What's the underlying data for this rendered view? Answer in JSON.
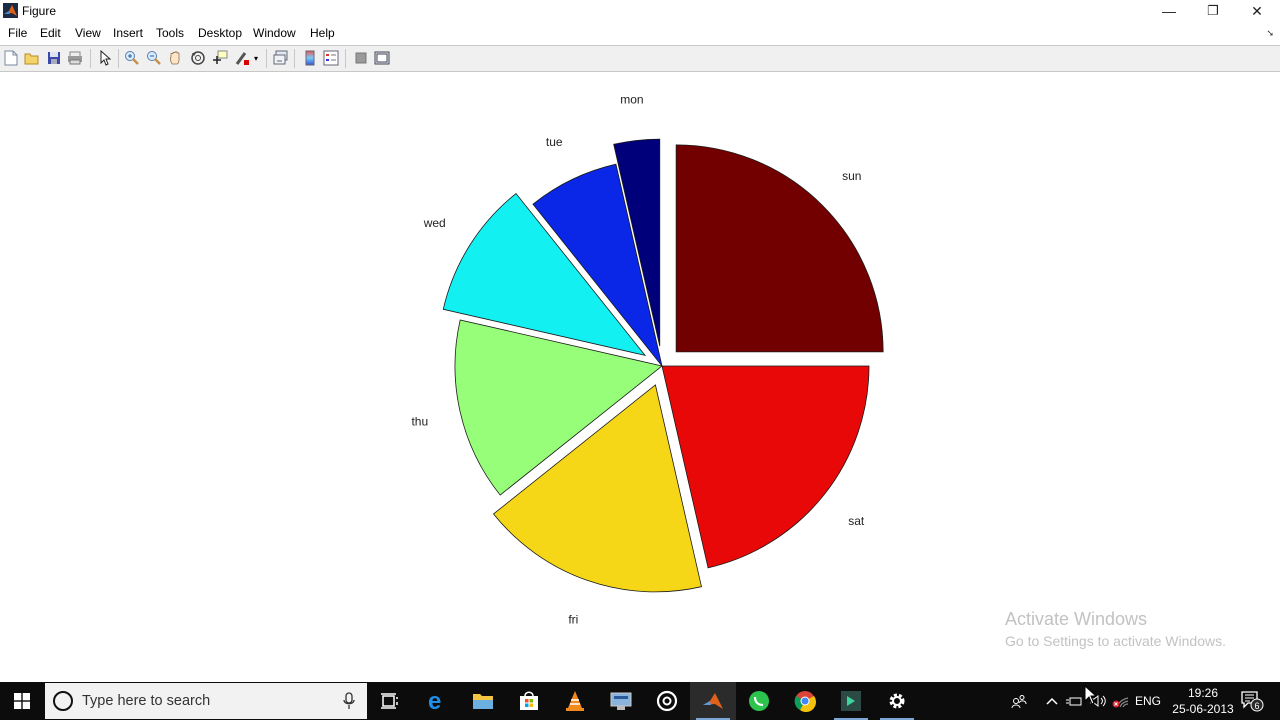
{
  "window": {
    "title": "Figure",
    "controls": {
      "minimize": "—",
      "restore": "❐",
      "close": "✕"
    }
  },
  "menubar": {
    "items": [
      "File",
      "Edit",
      "View",
      "Insert",
      "Tools",
      "Desktop",
      "Window",
      "Help"
    ]
  },
  "toolbar": {
    "buttons": [
      "new-figure",
      "open-file",
      "save-figure",
      "print-figure",
      "edit-plot",
      "zoom-in",
      "zoom-out",
      "pan",
      "rotate-3d",
      "data-cursor",
      "brush",
      "link-plot",
      "insert-colorbar",
      "insert-legend",
      "hide-plot-tools",
      "show-plot-tools"
    ]
  },
  "chart_data": {
    "type": "pie",
    "title": "",
    "categories": [
      "mon",
      "tue",
      "wed",
      "thu",
      "fri",
      "sat",
      "sun"
    ],
    "values": [
      1,
      2,
      3,
      4,
      5,
      6,
      7
    ],
    "explode": [
      1,
      0,
      1,
      0,
      1,
      0,
      1
    ],
    "colors": [
      "#00007a",
      "#0a26e6",
      "#12f0f2",
      "#97fe79",
      "#f6d718",
      "#e80808",
      "#720000"
    ],
    "start_angle_deg": 90,
    "direction": "counterclockwise"
  },
  "watermark": {
    "line1": "Activate Windows",
    "line2": "Go to Settings to activate Windows."
  },
  "taskbar": {
    "search_placeholder": "Type here to search",
    "apps": [
      "task-view",
      "edge",
      "file-explorer",
      "store",
      "vlc",
      "remote-desktop",
      "groove",
      "matlab",
      "whatsapp",
      "chrome",
      "app-green",
      "settings"
    ],
    "tray": {
      "language": "ENG",
      "time": "19:26",
      "date": "25-06-2013",
      "notification_count": "6"
    }
  }
}
